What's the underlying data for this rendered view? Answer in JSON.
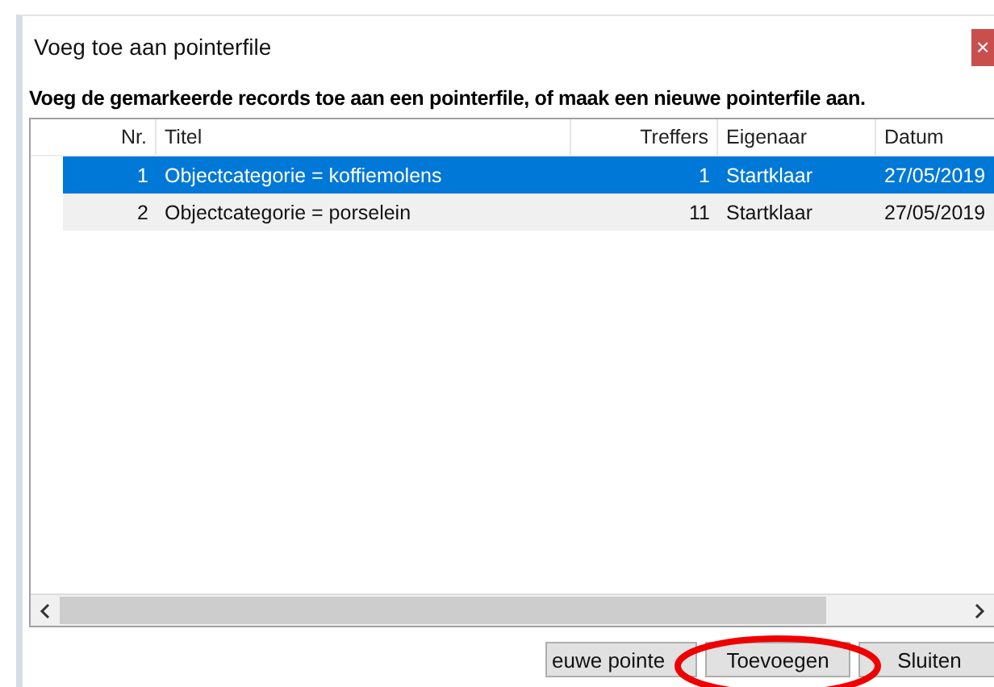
{
  "window": {
    "title": "Voeg toe aan pointerfile",
    "close": "×"
  },
  "heading": "Voeg de gemarkeerde records toe aan een pointerfile, of maak een nieuwe pointerfile aan.",
  "table": {
    "columns": [
      "Nr.",
      "Titel",
      "Treffers",
      "Eigenaar",
      "Datum"
    ],
    "rows": [
      {
        "nr": "1",
        "title": "Objectcategorie = koffiemolens",
        "hits": "1",
        "owner": "Startklaar",
        "date": "27/05/2019",
        "selected": true
      },
      {
        "nr": "2",
        "title": "Objectcategorie = porselein",
        "hits": "11",
        "owner": "Startklaar",
        "date": "27/05/2019",
        "selected": false
      }
    ]
  },
  "buttons": [
    "euwe pointe",
    "Toevoegen",
    "Sluiten"
  ]
}
